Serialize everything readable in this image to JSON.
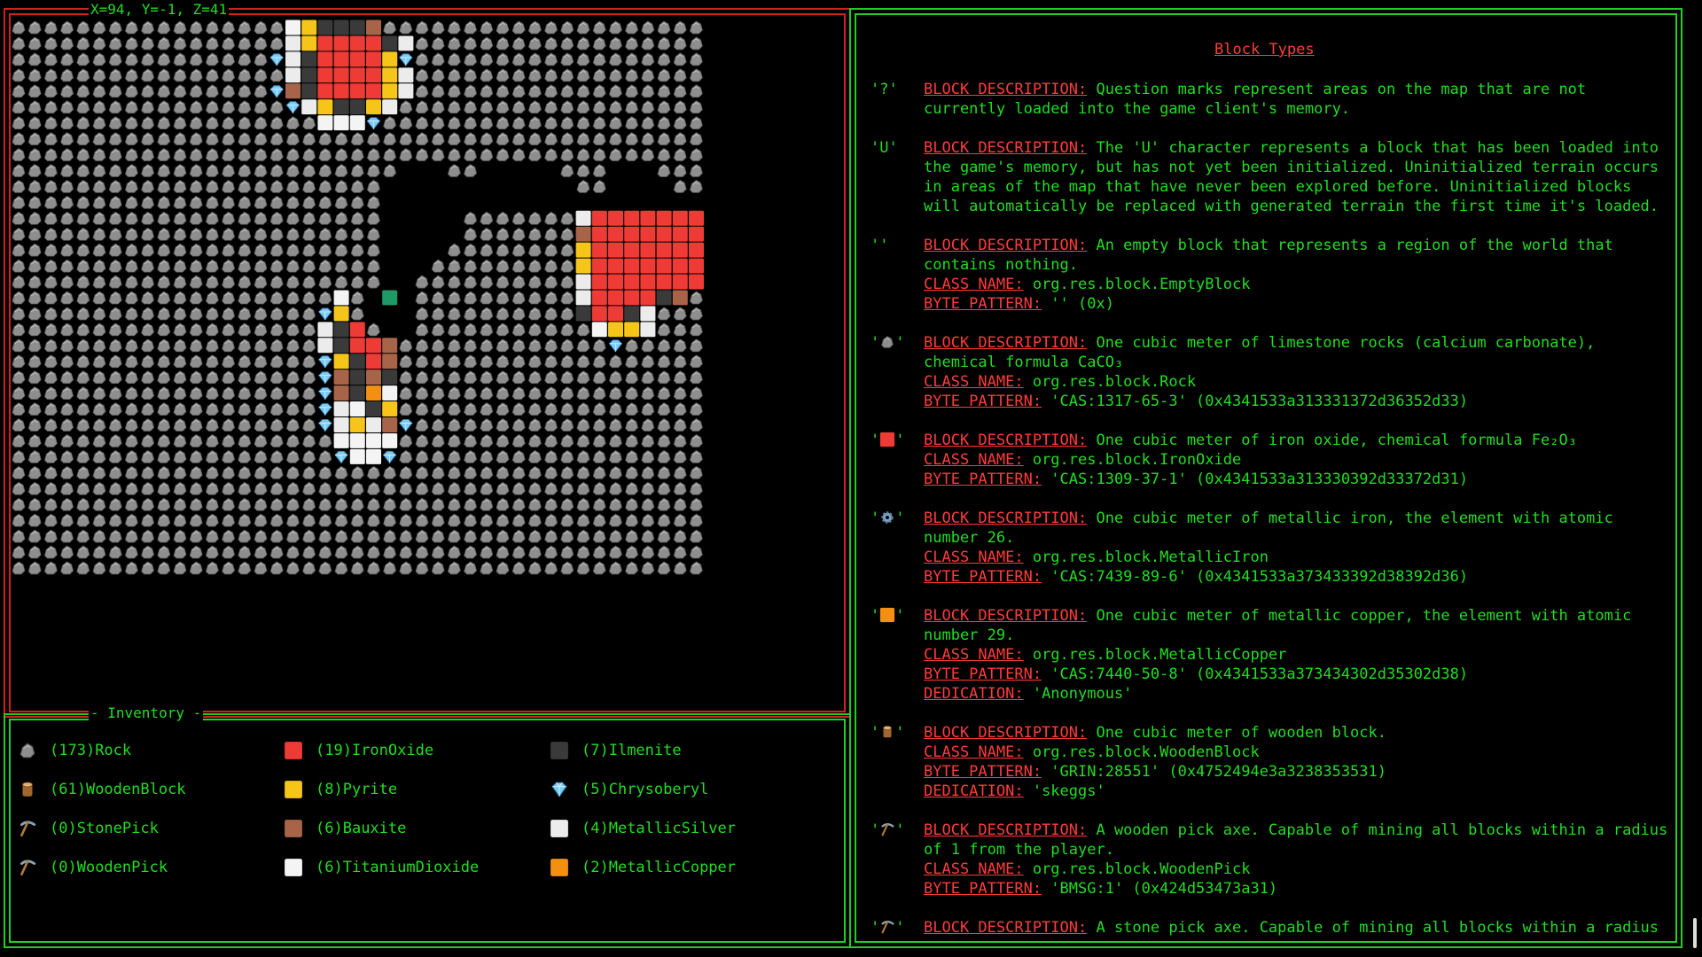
{
  "coords_label": "X=94, Y=-1, Z=41",
  "inventory_title": "Inventory",
  "colors": {
    "border_red": "#d02020",
    "border_green": "#20d020",
    "text_green": "#22dd22",
    "label_red": "#ff3b3b",
    "iron_oxide": "#ee3b35",
    "pyrite": "#f5c51a",
    "ilmenite": "#3a3a3a",
    "chrysoberyl": "#7ecbf2",
    "bauxite": "#a86448",
    "metallic_silver": "#ececec",
    "titanium_dioxide": "#f4f4f4",
    "metallic_copper": "#f39012",
    "player": "#1f9a66",
    "rock": "#8e8e8e"
  },
  "inventory": [
    {
      "icon": "rock-icon",
      "count": "(173)",
      "name": "Rock"
    },
    {
      "icon": "iron-oxide-icon",
      "count": "(19)",
      "name": "IronOxide"
    },
    {
      "icon": "ilmenite-icon",
      "count": "(7)",
      "name": "Ilmenite"
    },
    {
      "icon": "wood-log-icon",
      "count": "(61)",
      "name": "WoodenBlock"
    },
    {
      "icon": "pyrite-icon",
      "count": "(8)",
      "name": "Pyrite"
    },
    {
      "icon": "gem-icon",
      "count": "(5)",
      "name": "Chrysoberyl"
    },
    {
      "icon": "pickaxe-icon",
      "count": "(0)",
      "name": "StonePick"
    },
    {
      "icon": "bauxite-icon",
      "count": "(6)",
      "name": "Bauxite"
    },
    {
      "icon": "silver-icon",
      "count": "(4)",
      "name": "MetallicSilver"
    },
    {
      "icon": "pickaxe-icon",
      "count": "(0)",
      "name": "WoodenPick"
    },
    {
      "icon": "titanium-dioxide-icon",
      "count": "(6)",
      "name": "TitaniumDioxide"
    },
    {
      "icon": "copper-icon",
      "count": "(2)",
      "name": "MetallicCopper"
    }
  ],
  "info": {
    "title": "Block Types",
    "labels": {
      "desc": "BLOCK DESCRIPTION:",
      "class": "CLASS NAME:",
      "byte": "BYTE PATTERN:",
      "dedication": "DEDICATION:"
    },
    "entries": [
      {
        "symbol": "'?'",
        "icon": "",
        "desc": "Question marks represent areas on the map that are not currently loaded into the game client's memory."
      },
      {
        "symbol": "'U'",
        "icon": "",
        "desc": "The 'U' character represents a block that has been loaded into the game's memory, but has not yet been initialized.  Uninitialized terrain occurs  in areas of the map that have never been explored before.  Uninitialized blocks will automatically be replaced with generated terrain the first time it's loaded."
      },
      {
        "symbol": "''",
        "icon": "",
        "desc": "An empty block that represents a region of the world that contains nothing.",
        "class": "org.res.block.EmptyBlock",
        "byte": "'' (0x)"
      },
      {
        "symbol": "' '",
        "icon": "rock-icon",
        "desc": "One cubic meter of limestone rocks (calcium carbonate), chemical formula CaCO₃",
        "class": "org.res.block.Rock",
        "byte": "'CAS:1317-65-3' (0x4341533a313331372d36352d33)"
      },
      {
        "symbol": "' '",
        "icon": "iron-oxide-icon",
        "desc": "One cubic meter of iron oxide, chemical formula Fe₂O₃",
        "class": "org.res.block.IronOxide",
        "byte": "'CAS:1309-37-1' (0x4341533a313330392d33372d31)"
      },
      {
        "symbol": "' '",
        "icon": "gear-icon",
        "desc": "One cubic meter of metallic iron, the element with atomic number 26.",
        "class": "org.res.block.MetallicIron",
        "byte": "'CAS:7439-89-6' (0x4341533a373433392d38392d36)"
      },
      {
        "symbol": "' '",
        "icon": "copper-icon",
        "desc": "One cubic meter of metallic copper, the element with atomic number 29.",
        "class": "org.res.block.MetallicCopper",
        "byte": "'CAS:7440-50-8' (0x4341533a373434302d35302d38)",
        "dedication": "'Anonymous'"
      },
      {
        "symbol": "' '",
        "icon": "wood-log-icon",
        "desc": "One cubic meter of wooden block.",
        "class": "org.res.block.WoodenBlock",
        "byte": "'GRIN:28551' (0x4752494e3a3238353531)",
        "dedication": "'skeggs'"
      },
      {
        "symbol": "' '",
        "icon": "pickaxe-icon",
        "desc": "A wooden pick axe.  Capable of mining all blocks within a radius of 1 from the player.",
        "class": "org.res.block.WoodenPick",
        "byte": "'BMSG:1' (0x424d53473a31)"
      },
      {
        "symbol": "' '",
        "icon": "pickaxe-icon",
        "desc": "A stone pick axe.  Capable of mining all blocks within a radius"
      }
    ]
  },
  "map": {
    "legend": {
      ".": "empty",
      "R": "rock",
      "F": "iron_oxide",
      "Y": "pyrite",
      "K": "ilmenite",
      "D": "chrysoberyl",
      "B": "bauxite",
      "S": "metallic_silver",
      "T": "titanium_dioxide",
      "C": "metallic_copper",
      "P": "player"
    },
    "rows": [
      "RRRRRRRRRRRRRRRRRTYKKKBRRRRRRRRRRRRRRRRRRRR",
      "RRRRRRRRRRRRRRRRRSYFFFFKSRRRRRRRRRRRRRRRRRR",
      "RRRRRRRRRRRRRRRRDSKFFFFYDRRRRRRRRRRRRRRRRRR",
      "RRRRRRRRRRRRRRRRRSKFFFFYSRRRRRRRRRRRRRRRRRR",
      "RRRRRRRRRRRRRRRRDBKFFFFYSRRRRRRRRRRRRRRRRRR",
      "RRRRRRRRRRRRRRRRRDSYKKYSRRRRRRRRRRRRRRRRRRR",
      "RRRRRRRRRRRRRRRRRRRTTTDRRRRRRRRRRRRRRRRRRRR",
      "RRRRRRRRRRRRRRRRRRRRRRRRRRRRRRRRRRRRRRRRRRR",
      "RRRRRRRRRRRRRRRRRRRRRRRRRRRRRRRRRRRRRRRRRRR",
      "RRRRRRRRRRRRRRRRRRRRRRRR...RR.....RRR...RRR",
      "RRRRRRRRRRRRRRRRRRRRRRR............RR....RR",
      "RRRRRRRRRRRRRRRRRRRRRRR....................",
      "RRRRRRRRRRRRRRRRRRRRRRR.....RRRRRRRSFFFFFFF",
      "RRRRRRRRRRRRRRRRRRRRRRR.....RRRRRRRBFFFFFFF",
      "RRRRRRRRRRRRRRRRRRRRRRR....RRRRRRRRYFFFFFFF",
      "RRRRRRRRRRRRRRRRRRRRRRR...RRRRRRRRRYFFFFFFF",
      "RRRRRRRRRRRRRRRRRRRRRRR..RRRRRRRRRRSFFFFFFF",
      "RRRRRRRRRRRRRRRRRRRRTR.P.RRRRRRRRRRSFFFFKBR",
      "RRRRRRRRRRRRRRRRRRRDYR...RRRRRRRRRRKFFKSRRR",
      "RRRRRRRRRRRRRRRRRRRSKFR..RRRRRRRRRRRTYYSRRR",
      "RRRRRRRRRRRRRRRRRRRSKFFBRRRRRRRRRRRRRDRRRRR",
      "RRRRRRRRRRRRRRRRRRRDYKFBRRRRRRRRRRRRRRRRRRR",
      "RRRRRRRRRRRRRRRRRRRDBKBKRRRRRRRRRRRRRRRRRRR",
      "RRRRRRRRRRRRRRRRRRRDBKCTRRRRRRRRRRRRRRRRRRR",
      "RRRRRRRRRRRRRRRRRRRDSTKYRRRRRRRRRRRRRRRRRRR",
      "RRRRRRRRRRRRRRRRRRRDSYSBDRRRRRRRRRRRRRRRRRR",
      "RRRRRRRRRRRRRRRRRRRRTTTTRRRRRRRRRRRRRRRRRRR",
      "RRRRRRRRRRRRRRRRRRRRDTTDRRRRRRRRRRRRRRRRRRR",
      "RRRRRRRRRRRRRRRRRRRRRRRRRRRRRRRRRRRRRRRRRRR",
      "RRRRRRRRRRRRRRRRRRRRRRRRRRRRRRRRRRRRRRRRRRR",
      "RRRRRRRRRRRRRRRRRRRRRRRRRRRRRRRRRRRRRRRRRRR",
      "RRRRRRRRRRRRRRRRRRRRRRRRRRRRRRRRRRRRRRRRRRR",
      "RRRRRRRRRRRRRRRRRRRRRRRRRRRRRRRRRRRRRRRRRRR",
      "RRRRRRRRRRRRRRRRRRRRRRRRRRRRRRRRRRRRRRRRRRR",
      "RRRRRRRRRRRRRRRRRRRRRRRRRRRRRRRRRRRRRRRRRRR"
    ]
  }
}
